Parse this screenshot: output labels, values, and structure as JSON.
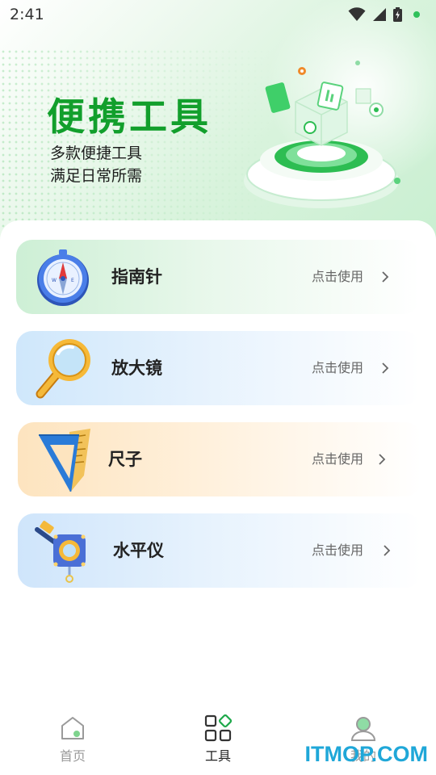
{
  "status_bar": {
    "time": "2:41",
    "icons": [
      "wifi-icon",
      "signal-icon",
      "battery-charging-icon",
      "notification-dot-icon"
    ]
  },
  "hero": {
    "title": "便携工具",
    "subtitle_line1": "多款便捷工具",
    "subtitle_line2": "满足日常所需"
  },
  "tools": [
    {
      "name": "指南针",
      "action": "点击使用",
      "icon": "compass-icon"
    },
    {
      "name": "放大镜",
      "action": "点击使用",
      "icon": "magnifier-icon"
    },
    {
      "name": "尺子",
      "action": "点击使用",
      "icon": "ruler-triangle-icon"
    },
    {
      "name": "水平仪",
      "action": "点击使用",
      "icon": "level-icon"
    }
  ],
  "bottom_nav": {
    "items": [
      {
        "label": "首页",
        "icon": "home-icon",
        "active": false
      },
      {
        "label": "工具",
        "icon": "tools-grid-icon",
        "active": true
      },
      {
        "label": "我的",
        "icon": "profile-icon",
        "active": false
      }
    ]
  },
  "watermark": "ITMOP.COM",
  "colors": {
    "brand_green": "#129f2c",
    "compass_card": "#cdefd5",
    "magnifier_card": "#cfe7fb",
    "ruler_card": "#fde4bf",
    "level_card": "#cfe5fb",
    "watermark": "#1fa7d8"
  }
}
